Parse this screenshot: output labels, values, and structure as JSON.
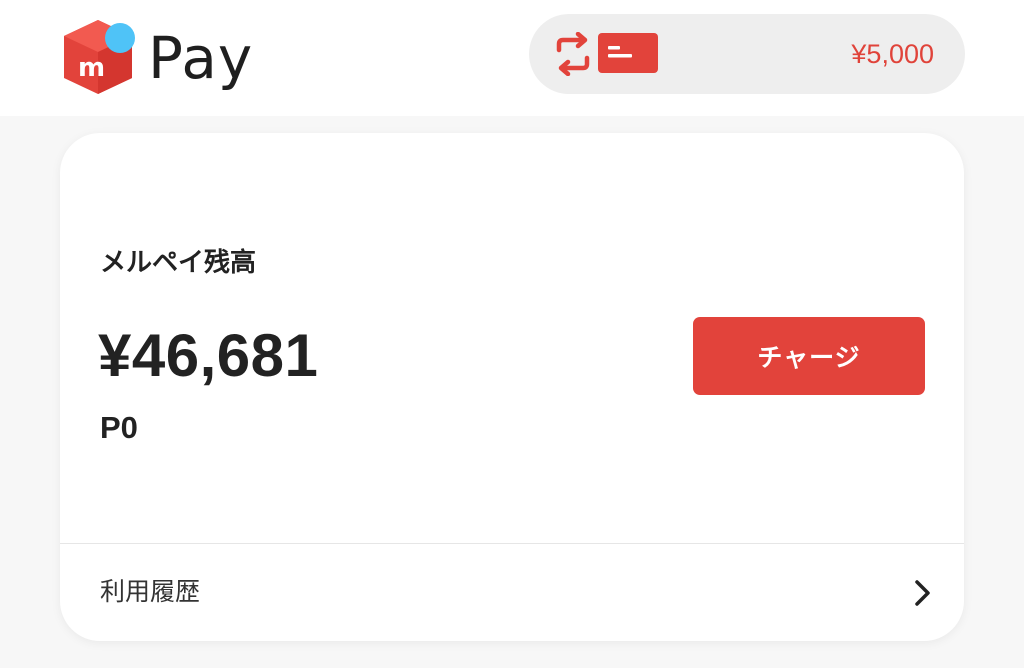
{
  "header": {
    "logo_text": "Pay",
    "logo_mark_letter": "m",
    "balance_pill": {
      "amount": "¥5,000",
      "swap_icon": "swap-arrows-icon",
      "card_icon": "card-icon"
    }
  },
  "balance_card": {
    "label": "メルペイ残高",
    "amount": "¥46,681",
    "points": "P0",
    "charge_button": "チャージ",
    "history_label": "利用履歴",
    "history_icon": "chevron-right-icon"
  },
  "colors": {
    "brand_red": "#e2433b",
    "logo_blue": "#4fc3f7",
    "pill_background": "#eeeeee",
    "text_dark": "#222222"
  }
}
